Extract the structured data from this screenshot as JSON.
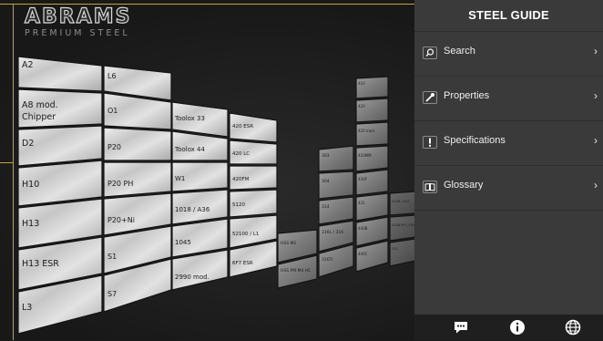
{
  "brand": {
    "name": "ABRAMS",
    "tagline": "PREMIUM STEEL"
  },
  "panel": {
    "title": "STEEL GUIDE",
    "menu": [
      {
        "label": "Search",
        "icon": "search-icon"
      },
      {
        "label": "Properties",
        "icon": "wrench-icon"
      },
      {
        "label": "Specifications",
        "icon": "exclamation-icon"
      },
      {
        "label": "Glossary",
        "icon": "book-icon"
      }
    ]
  },
  "bottom_bar": {
    "icons": [
      "chat-icon",
      "info-icon",
      "globe-icon"
    ]
  },
  "steel_wall": {
    "col1": [
      "A2",
      "A8 mod.",
      "Chipper",
      "D2",
      "H10",
      "H13",
      "H13 ESR",
      "L3"
    ],
    "col2": [
      "L6",
      "O1",
      "P20",
      "P20 PH",
      "P20+Ni",
      "S1",
      "S7"
    ],
    "col3": [
      "Toolox 33",
      "Toolox 44",
      "W1",
      "1018 / A36",
      "1045",
      "2990 mod."
    ],
    "col4": [
      "420 ESR",
      "420 LC",
      "420FM",
      "5120",
      "52100 / L1",
      "6F7 ESR"
    ],
    "col5": [
      "HSS M2",
      "HSS PM M4 HC"
    ],
    "col6": [
      "303",
      "304",
      "314",
      "316L / 316",
      "316Ti"
    ],
    "col7": [
      "410",
      "420",
      "420 mod.",
      "420MM",
      "430F",
      "431",
      "440B",
      "440C"
    ],
    "col8": [
      "410B / 410",
      "410B PH / 430Z PH",
      "315"
    ]
  },
  "colors": {
    "accent": "#c8a42a",
    "panel": "#3a3a3a",
    "background": "#1b1b1b"
  }
}
